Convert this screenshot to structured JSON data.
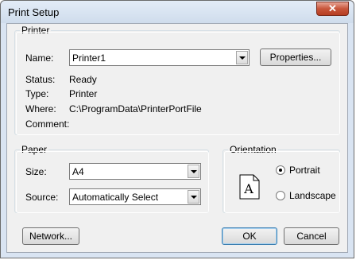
{
  "window": {
    "title": "Print Setup",
    "close_glyph": "✕"
  },
  "printer": {
    "group_label": "Printer",
    "name_label": "Name:",
    "name_value": "Printer1",
    "properties_label": "Properties...",
    "status_label": "Status:",
    "status_value": "Ready",
    "type_label": "Type:",
    "type_value": "Printer",
    "where_label": "Where:",
    "where_value": "C:\\ProgramData\\PrinterPortFile",
    "comment_label": "Comment:",
    "comment_value": ""
  },
  "paper": {
    "group_label": "Paper",
    "size_label": "Size:",
    "size_value": "A4",
    "source_label": "Source:",
    "source_value": "Automatically Select"
  },
  "orientation": {
    "group_label": "Orientation",
    "page_letter": "A",
    "portrait_label": "Portrait",
    "landscape_label": "Landscape",
    "selected": "Portrait"
  },
  "buttons": {
    "network_label": "Network...",
    "ok_label": "OK",
    "cancel_label": "Cancel"
  },
  "icons": [
    "close-icon",
    "dropdown-arrow-icon",
    "page-portrait-icon"
  ]
}
